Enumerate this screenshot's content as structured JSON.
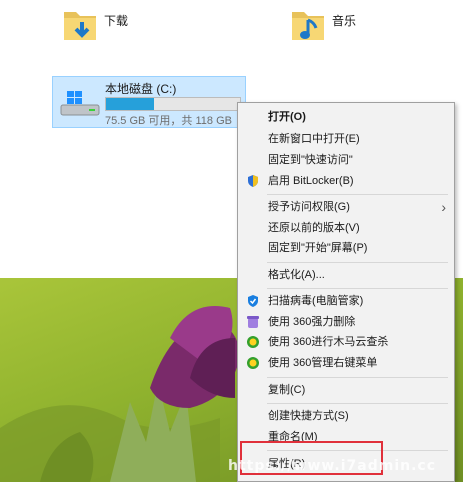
{
  "folders": [
    {
      "label": "下载",
      "icon": "downloads-folder-icon"
    },
    {
      "label": "音乐",
      "icon": "music-folder-icon"
    }
  ],
  "drive": {
    "name": "本地磁盘 (C:)",
    "space_text": "75.5 GB 可用，共 118 GB",
    "used_fraction": 0.36,
    "icon": "windows-drive-icon"
  },
  "menu": {
    "items": [
      {
        "label": "打开(O)"
      },
      {
        "label": "在新窗口中打开(E)"
      },
      {
        "label": "固定到\"快速访问\""
      },
      {
        "label": "启用 BitLocker(B)",
        "icon": "shield-icon"
      },
      {
        "label": "授予访问权限(G)"
      },
      {
        "label": "还原以前的版本(V)"
      },
      {
        "label": "固定到\"开始\"屏幕(P)"
      },
      {
        "label": "格式化(A)..."
      },
      {
        "label": "扫描病毒(电脑管家)",
        "icon": "tencent-shield-icon"
      },
      {
        "label": "使用 360强力删除",
        "icon": "360-delete-icon"
      },
      {
        "label": "使用 360进行木马云查杀",
        "icon": "360-scan-icon"
      },
      {
        "label": "使用 360管理右键菜单",
        "icon": "360-menu-icon"
      },
      {
        "label": "复制(C)"
      },
      {
        "label": "创建快捷方式(S)"
      },
      {
        "label": "重命名(M)"
      },
      {
        "label": "属性(R)"
      }
    ]
  },
  "watermark": "https://www.i7admin.cc",
  "colors": {
    "selection": "#cce8ff",
    "progress": "#26a0da",
    "highlight_box": "#e0303a"
  }
}
